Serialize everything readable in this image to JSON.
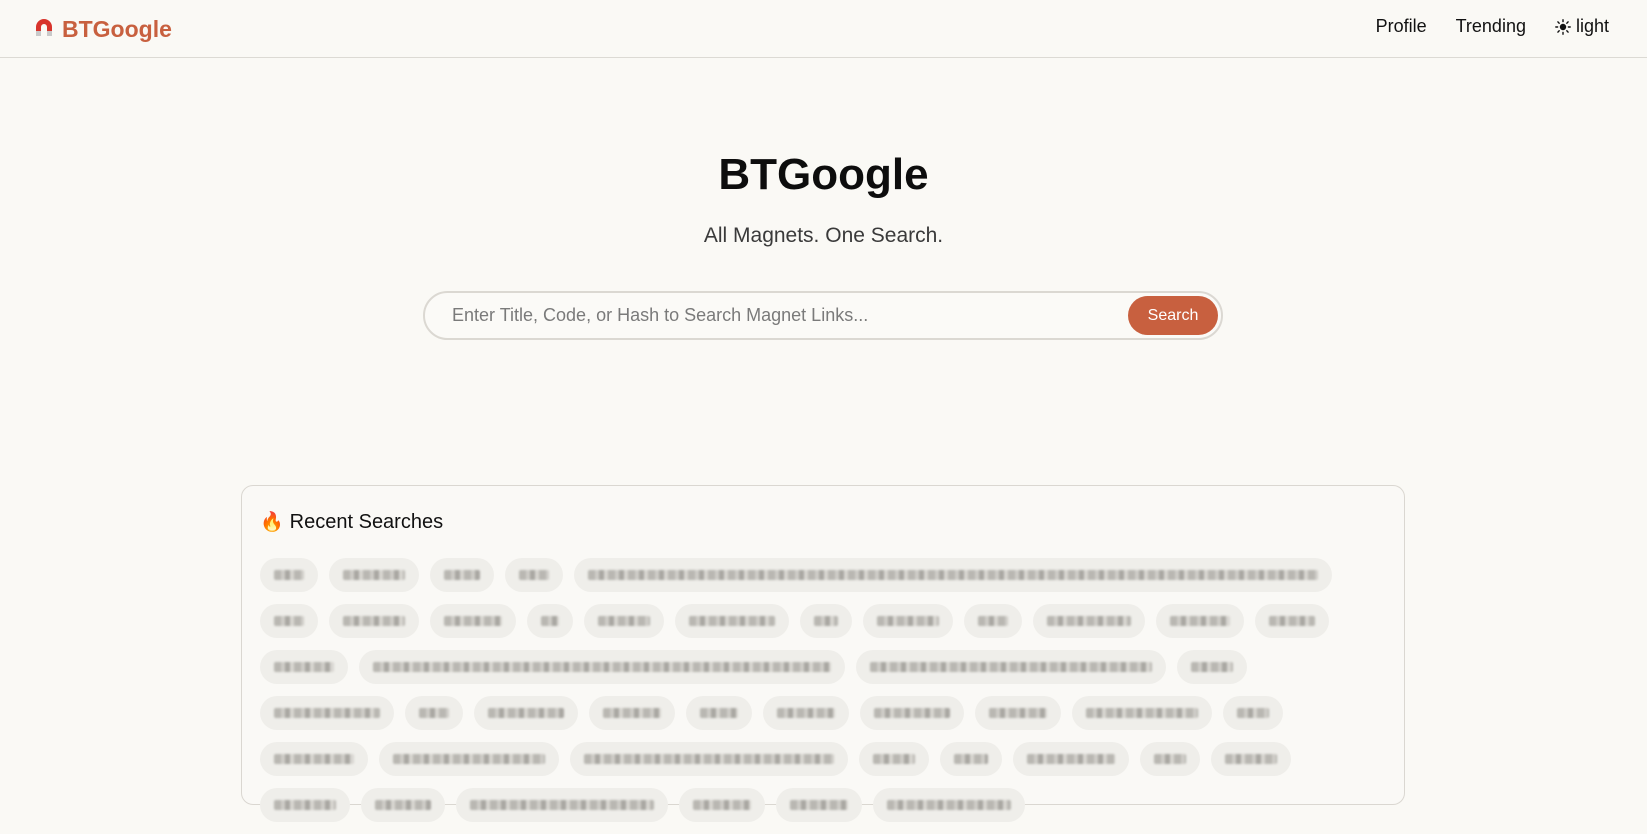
{
  "header": {
    "brand": "BTGoogle",
    "nav": {
      "profile": "Profile",
      "trending": "Trending",
      "theme": "light"
    }
  },
  "hero": {
    "title": "BTGoogle",
    "subtitle": "All Magnets. One Search."
  },
  "search": {
    "placeholder": "Enter Title, Code, or Hash to Search Magnet Links...",
    "button_label": "Search"
  },
  "recent": {
    "icon": "fire-icon",
    "title": "Recent Searches"
  },
  "colors": {
    "accent": "#c8603f",
    "background": "#faf9f5"
  }
}
